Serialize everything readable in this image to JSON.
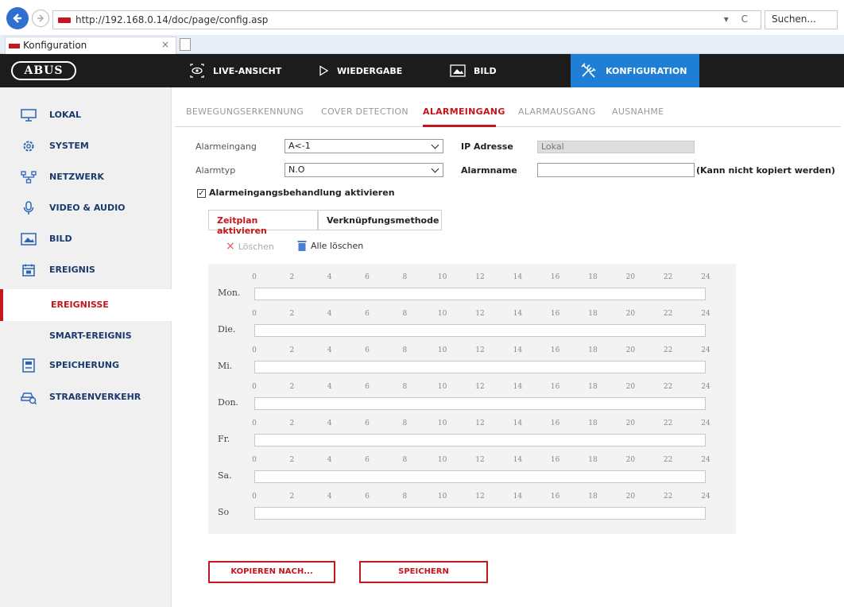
{
  "browser": {
    "url": "http://192.168.0.14/doc/page/config.asp",
    "url_controls": "▾ C",
    "search_placeholder": "Suchen...",
    "tab_title": "Konfiguration",
    "tab_close": "×"
  },
  "header": {
    "logo": "ABUS",
    "nav": [
      {
        "label": "LIVE-ANSICHT",
        "icon": "camera-eye-icon"
      },
      {
        "label": "WIEDERGABE",
        "icon": "play-icon"
      },
      {
        "label": "BILD",
        "icon": "image-icon"
      },
      {
        "label": "KONFIGURATION",
        "icon": "tools-icon",
        "active": true
      }
    ]
  },
  "sidebar": {
    "items": [
      {
        "label": "LOKAL",
        "icon": "monitor-icon"
      },
      {
        "label": "SYSTEM",
        "icon": "gear-icon"
      },
      {
        "label": "NETZWERK",
        "icon": "network-icon"
      },
      {
        "label": "VIDEO & AUDIO",
        "icon": "microphone-icon"
      },
      {
        "label": "BILD",
        "icon": "image-icon"
      },
      {
        "label": "EREIGNIS",
        "icon": "calendar-icon"
      },
      {
        "label": "EREIGNISSE",
        "sub": true,
        "active": true
      },
      {
        "label": "SMART-EREIGNIS",
        "sub": true
      },
      {
        "label": "SPEICHERUNG",
        "icon": "storage-icon"
      },
      {
        "label": "STRAßENVERKEHR",
        "icon": "car-icon"
      }
    ]
  },
  "subtabs": [
    "BEWEGUNGSERKENNUNG",
    "COVER DETECTION",
    "ALARMEINGANG",
    "ALARMAUSGANG",
    "AUSNAHME"
  ],
  "form": {
    "alarm_input_label": "Alarmeingang",
    "alarm_input_value": "A<-1",
    "ip_label": "IP Adresse",
    "ip_value": "Lokal",
    "alarm_type_label": "Alarmtyp",
    "alarm_type_value": "N.O",
    "alarm_name_label": "Alarmname",
    "alarm_name_value": "",
    "alarm_name_note": "(Kann nicht kopiert werden)",
    "enable_label": "Alarmeingangsbehandlung aktivieren",
    "enable_checked": "✓"
  },
  "method_tabs": {
    "schedule": "Zeitplan aktivieren",
    "linkage": "Verknüpfungsmethode"
  },
  "tools": {
    "delete_icon": "×",
    "delete": "Löschen",
    "delete_all": "Alle löschen"
  },
  "schedule": {
    "ticks": [
      "0",
      "2",
      "4",
      "6",
      "8",
      "10",
      "12",
      "14",
      "16",
      "18",
      "20",
      "22",
      "24"
    ],
    "days": [
      "Mon.",
      "Die.",
      "Mi.",
      "Don.",
      "Fr.",
      "Sa.",
      "So"
    ]
  },
  "buttons": {
    "copy": "KOPIEREN NACH...",
    "save": "SPEICHERN"
  }
}
